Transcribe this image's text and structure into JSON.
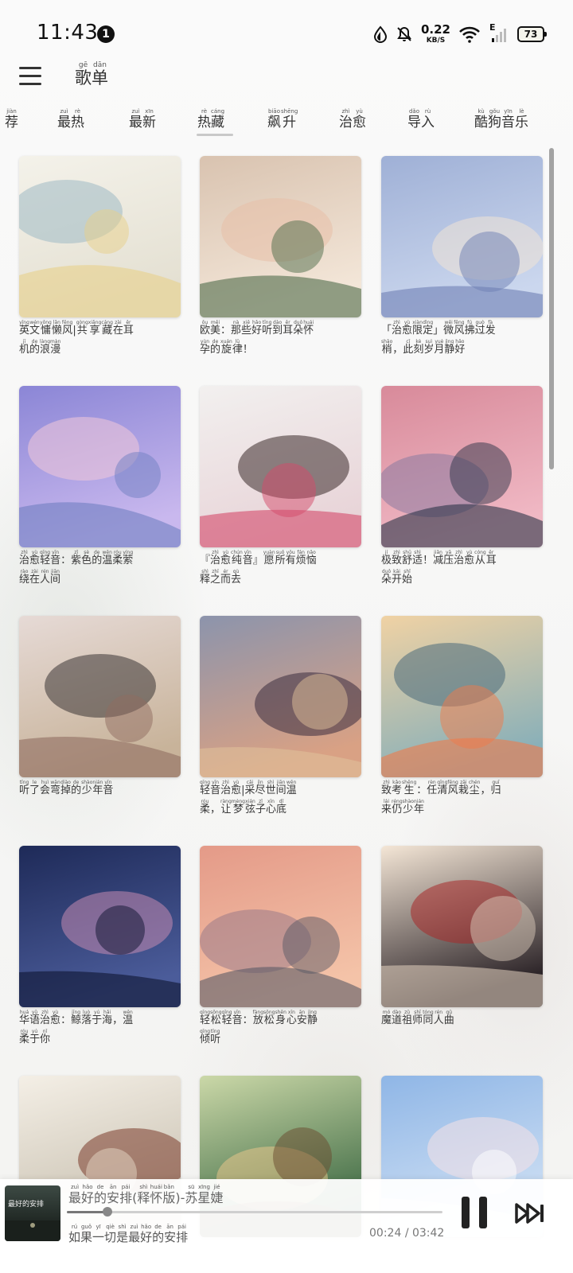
{
  "status_bar": {
    "time": "11:43",
    "notification_count": "1",
    "net_speed_value": "0.22",
    "net_speed_unit": "KB/S",
    "signal_type": "E",
    "battery": "73"
  },
  "header": {
    "menu_icon": "hamburger-menu-icon",
    "title": [
      {
        "hz": "歌",
        "py": "gē"
      },
      {
        "hz": "单",
        "py": "dān"
      }
    ]
  },
  "tabs": [
    {
      "chars": [
        {
          "hz": "荐",
          "py": "jiàn"
        }
      ]
    },
    {
      "chars": [
        {
          "hz": "最",
          "py": "zuì"
        },
        {
          "hz": "热",
          "py": "rè"
        }
      ]
    },
    {
      "chars": [
        {
          "hz": "最",
          "py": "zuì"
        },
        {
          "hz": "新",
          "py": "xīn"
        }
      ]
    },
    {
      "chars": [
        {
          "hz": "热",
          "py": "rè"
        },
        {
          "hz": "藏",
          "py": "cáng"
        }
      ],
      "active": true
    },
    {
      "chars": [
        {
          "hz": "飙",
          "py": "biāo"
        },
        {
          "hz": "升",
          "py": "shēng"
        }
      ]
    },
    {
      "chars": [
        {
          "hz": "治",
          "py": "zhì"
        },
        {
          "hz": "愈",
          "py": "yù"
        }
      ]
    },
    {
      "chars": [
        {
          "hz": "导",
          "py": "dǎo"
        },
        {
          "hz": "入",
          "py": "rù"
        }
      ]
    },
    {
      "chars": [
        {
          "hz": "酷",
          "py": "kù"
        },
        {
          "hz": "狗",
          "py": "gǒu"
        },
        {
          "hz": "音",
          "py": "yīn"
        },
        {
          "hz": "乐",
          "py": "lè"
        }
      ]
    }
  ],
  "playlists": [
    {
      "lines": [
        [
          [
            "英",
            "yīng"
          ],
          [
            "文",
            "wén"
          ],
          [
            "慵",
            "yōng"
          ],
          [
            "懒",
            "lǎn"
          ],
          [
            "风",
            "fēng"
          ],
          [
            "|",
            ""
          ],
          [
            "共",
            "gòng"
          ],
          [
            "享",
            "xiǎng"
          ],
          [
            "藏",
            "cáng"
          ],
          [
            "在",
            "zài"
          ],
          [
            "耳",
            "ěr"
          ]
        ],
        [
          [
            "机",
            "jī"
          ],
          [
            "的",
            "de"
          ],
          [
            "浪",
            "làng"
          ],
          [
            "漫",
            "màn"
          ]
        ]
      ]
    },
    {
      "lines": [
        [
          [
            "欧",
            "ōu"
          ],
          [
            "美",
            "měi"
          ],
          [
            "：",
            ""
          ],
          [
            "那",
            "nà"
          ],
          [
            "些",
            "xiē"
          ],
          [
            "好",
            "hǎo"
          ],
          [
            "听",
            "tīng"
          ],
          [
            "到",
            "dào"
          ],
          [
            "耳",
            "ěr"
          ],
          [
            "朵",
            "duǒ"
          ],
          [
            "怀",
            "huái"
          ]
        ],
        [
          [
            "孕",
            "yùn"
          ],
          [
            "的",
            "de"
          ],
          [
            "旋",
            "xuán"
          ],
          [
            "律",
            "lǜ"
          ],
          [
            "！",
            ""
          ]
        ]
      ]
    },
    {
      "lines": [
        [
          [
            "「",
            ""
          ],
          [
            "治",
            "zhì"
          ],
          [
            "愈",
            "yù"
          ],
          [
            "限",
            "xiàn"
          ],
          [
            "定",
            "dìng"
          ],
          [
            "」",
            ""
          ],
          [
            "微",
            "wēi"
          ],
          [
            "风",
            "fēng"
          ],
          [
            "拂",
            "fú"
          ],
          [
            "过",
            "guò"
          ],
          [
            "发",
            "fà"
          ]
        ],
        [
          [
            "梢",
            "shāo"
          ],
          [
            "，",
            ""
          ],
          [
            "此",
            "cǐ"
          ],
          [
            "刻",
            "kè"
          ],
          [
            "岁",
            "suì"
          ],
          [
            "月",
            "yuè"
          ],
          [
            "静",
            "jìng"
          ],
          [
            "好",
            "hǎo"
          ]
        ]
      ]
    },
    {
      "lines": [
        [
          [
            "治",
            "zhì"
          ],
          [
            "愈",
            "yù"
          ],
          [
            "轻",
            "qīng"
          ],
          [
            "音",
            "yīn"
          ],
          [
            "：",
            ""
          ],
          [
            "紫",
            "zǐ"
          ],
          [
            "色",
            "sè"
          ],
          [
            "的",
            "de"
          ],
          [
            "温",
            "wēn"
          ],
          [
            "柔",
            "róu"
          ],
          [
            "萦",
            "yíng"
          ]
        ],
        [
          [
            "绕",
            "rào"
          ],
          [
            "在",
            "zài"
          ],
          [
            "人",
            "rén"
          ],
          [
            "间",
            "jiān"
          ]
        ]
      ]
    },
    {
      "lines": [
        [
          [
            "『",
            ""
          ],
          [
            "治",
            "zhì"
          ],
          [
            "愈",
            "yù"
          ],
          [
            "纯",
            "chún"
          ],
          [
            "音",
            "yīn"
          ],
          [
            "』",
            ""
          ],
          [
            "愿",
            "yuàn"
          ],
          [
            "所",
            "suǒ"
          ],
          [
            "有",
            "yǒu"
          ],
          [
            "烦",
            "fán"
          ],
          [
            "恼",
            "nǎo"
          ]
        ],
        [
          [
            "释",
            "shì"
          ],
          [
            "之",
            "zhī"
          ],
          [
            "而",
            "ér"
          ],
          [
            "去",
            "qù"
          ]
        ]
      ]
    },
    {
      "lines": [
        [
          [
            "极",
            "jí"
          ],
          [
            "致",
            "zhì"
          ],
          [
            "舒",
            "shū"
          ],
          [
            "适",
            "shì"
          ],
          [
            "！",
            ""
          ],
          [
            "减",
            "jiǎn"
          ],
          [
            "压",
            "yā"
          ],
          [
            "治",
            "zhì"
          ],
          [
            "愈",
            "yù"
          ],
          [
            "从",
            "cóng"
          ],
          [
            "耳",
            "ěr"
          ]
        ],
        [
          [
            "朵",
            "duǒ"
          ],
          [
            "开",
            "kāi"
          ],
          [
            "始",
            "shǐ"
          ]
        ]
      ]
    },
    {
      "lines": [
        [
          [
            "听",
            "tīng"
          ],
          [
            "了",
            "le"
          ],
          [
            "会",
            "huì"
          ],
          [
            "弯",
            "wān"
          ],
          [
            "掉",
            "diào"
          ],
          [
            "的",
            "de"
          ],
          [
            "少",
            "shào"
          ],
          [
            "年",
            "nián"
          ],
          [
            "音",
            "yīn"
          ]
        ]
      ]
    },
    {
      "lines": [
        [
          [
            "轻",
            "qīng"
          ],
          [
            "音",
            "yīn"
          ],
          [
            "治",
            "zhì"
          ],
          [
            "愈",
            "yù"
          ],
          [
            "|",
            ""
          ],
          [
            "采",
            "cǎi"
          ],
          [
            "尽",
            "jìn"
          ],
          [
            "世",
            "shì"
          ],
          [
            "间",
            "jiān"
          ],
          [
            "温",
            "wēn"
          ]
        ],
        [
          [
            "柔",
            "róu"
          ],
          [
            "，",
            ""
          ],
          [
            "让",
            "ràng"
          ],
          [
            "梦",
            "mèng"
          ],
          [
            "弦",
            "xián"
          ],
          [
            "子",
            "zǐ"
          ],
          [
            "心",
            "xīn"
          ],
          [
            "底",
            "dǐ"
          ]
        ]
      ]
    },
    {
      "lines": [
        [
          [
            "致",
            "zhì"
          ],
          [
            "考",
            "kǎo"
          ],
          [
            "生",
            "shēng"
          ],
          [
            "：",
            ""
          ],
          [
            "任",
            "rèn"
          ],
          [
            "清",
            "qīng"
          ],
          [
            "风",
            "fēng"
          ],
          [
            "栽",
            "zāi"
          ],
          [
            "尘",
            "chén"
          ],
          [
            "，",
            ""
          ],
          [
            "归",
            "guī"
          ]
        ],
        [
          [
            "来",
            "lái"
          ],
          [
            "仍",
            "réng"
          ],
          [
            "少",
            "shào"
          ],
          [
            "年",
            "nián"
          ]
        ]
      ]
    },
    {
      "lines": [
        [
          [
            "华",
            "huá"
          ],
          [
            "语",
            "yǔ"
          ],
          [
            "治",
            "zhì"
          ],
          [
            "愈",
            "yù"
          ],
          [
            "：",
            ""
          ],
          [
            "鲸",
            "jīng"
          ],
          [
            "落",
            "luò"
          ],
          [
            "于",
            "yú"
          ],
          [
            "海",
            "hǎi"
          ],
          [
            "，",
            ""
          ],
          [
            "温",
            "wēn"
          ]
        ],
        [
          [
            "柔",
            "róu"
          ],
          [
            "于",
            "yú"
          ],
          [
            "你",
            "nǐ"
          ]
        ]
      ]
    },
    {
      "lines": [
        [
          [
            "轻",
            "qīng"
          ],
          [
            "松",
            "sōng"
          ],
          [
            "轻",
            "qīng"
          ],
          [
            "音",
            "yīn"
          ],
          [
            "：",
            ""
          ],
          [
            "放",
            "fàng"
          ],
          [
            "松",
            "sōng"
          ],
          [
            "身",
            "shēn"
          ],
          [
            "心",
            "xīn"
          ],
          [
            "安",
            "ān"
          ],
          [
            "静",
            "jìng"
          ]
        ],
        [
          [
            "倾",
            "qīng"
          ],
          [
            "听",
            "tīng"
          ]
        ]
      ]
    },
    {
      "lines": [
        [
          [
            "魔",
            "mó"
          ],
          [
            "道",
            "dào"
          ],
          [
            "祖",
            "zǔ"
          ],
          [
            "师",
            "shī"
          ],
          [
            "同",
            "tóng"
          ],
          [
            "人",
            "rén"
          ],
          [
            "曲",
            "qǔ"
          ]
        ]
      ]
    },
    {
      "lines": []
    },
    {
      "lines": []
    },
    {
      "lines": []
    }
  ],
  "player": {
    "song": [
      [
        "最",
        "zuì"
      ],
      [
        "好",
        "hǎo"
      ],
      [
        "的",
        "de"
      ],
      [
        "安",
        "ān"
      ],
      [
        "排",
        "pái"
      ],
      [
        "(",
        ""
      ],
      [
        "释",
        "shì"
      ],
      [
        "怀",
        "huái"
      ],
      [
        "版",
        "bǎn"
      ],
      [
        ")",
        ""
      ],
      [
        "-",
        ""
      ],
      [
        "苏",
        "sū"
      ],
      [
        "星",
        "xīng"
      ],
      [
        "婕",
        "jié"
      ]
    ],
    "lyric": [
      [
        "如",
        "rú"
      ],
      [
        "果",
        "guǒ"
      ],
      [
        "一",
        "yī"
      ],
      [
        "切",
        "qiè"
      ],
      [
        "是",
        "shì"
      ],
      [
        "最",
        "zuì"
      ],
      [
        "好",
        "hǎo"
      ],
      [
        "的",
        "de"
      ],
      [
        "安",
        "ān"
      ],
      [
        "排",
        "pái"
      ]
    ],
    "art_text": "最好的安排",
    "current_time": "00:24",
    "time_separator": "/",
    "total_time": "03:42",
    "progress": 0.108
  }
}
